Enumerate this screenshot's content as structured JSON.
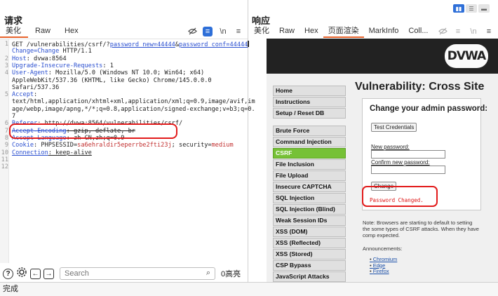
{
  "request": {
    "title": "请求",
    "tabs": [
      "美化",
      "Raw",
      "Hex"
    ],
    "lines": [
      {
        "n": "1",
        "parts": [
          [
            "GET /vulnerabilities/csrf/?",
            "v"
          ],
          [
            "password_new=44444",
            "k ul"
          ],
          [
            "&",
            "v"
          ],
          [
            "password_conf=44444",
            "k ul"
          ]
        ]
      },
      {
        "n": "",
        "parts": [
          [
            "Change=Change",
            "k"
          ],
          [
            " HTTP/1.1",
            "v"
          ]
        ]
      },
      {
        "n": "2",
        "parts": [
          [
            "Host",
            "k"
          ],
          [
            ": dvwa:8564",
            "v"
          ]
        ]
      },
      {
        "n": "3",
        "parts": [
          [
            "Upgrade-Insecure-Requests",
            "k"
          ],
          [
            ": 1",
            "v"
          ]
        ]
      },
      {
        "n": "4",
        "parts": [
          [
            "User-Agent",
            "k"
          ],
          [
            ": Mozilla/5.0 (Windows NT 10.0; Win64; x64)",
            "v"
          ]
        ]
      },
      {
        "n": "",
        "parts": [
          [
            "AppleWebKit/537.36 (KHTML, like Gecko) Chrome/145.0.0.0",
            "v"
          ]
        ]
      },
      {
        "n": "",
        "parts": [
          [
            "Safari/537.36",
            "v"
          ]
        ]
      },
      {
        "n": "5",
        "parts": [
          [
            "Accept",
            "k"
          ],
          [
            ":",
            "v"
          ]
        ]
      },
      {
        "n": "",
        "parts": [
          [
            "text/html,application/xhtml+xml,application/xml;q=0.9,image/avif,im",
            "v"
          ]
        ]
      },
      {
        "n": "",
        "parts": [
          [
            "age/webp,image/apng,*/*;q=0.8,application/signed-exchange;v=b3;q=0.",
            "v"
          ]
        ]
      },
      {
        "n": "",
        "parts": [
          [
            "7",
            "v"
          ]
        ]
      },
      {
        "n": "6",
        "parts": [
          [
            "Referer",
            "k"
          ],
          [
            ": http://dvwa:8564/vulnerabilities/csrf/",
            "v"
          ]
        ]
      },
      {
        "n": "7",
        "parts": [
          [
            "Accept-Encoding",
            "k strike"
          ],
          [
            ": gzip, deflate, br",
            "v strike"
          ]
        ]
      },
      {
        "n": "8",
        "parts": [
          [
            "Accept-Language",
            "k"
          ],
          [
            ": zh-CN,zh;q=0.9",
            "v"
          ]
        ]
      },
      {
        "n": "9",
        "parts": [
          [
            "Cookie",
            "k"
          ],
          [
            ": PHPSESSID=",
            "v"
          ],
          [
            "sa6ehraldir5eperrbe2fti23j",
            "r"
          ],
          [
            "; security=",
            "v"
          ],
          [
            "medium",
            "r"
          ]
        ]
      },
      {
        "n": "10",
        "parts": [
          [
            "Connection",
            "k ul"
          ],
          [
            ": keep-alive",
            "v ul"
          ]
        ]
      },
      {
        "n": "11",
        "parts": []
      },
      {
        "n": "12",
        "parts": []
      }
    ],
    "search_placeholder": "Search",
    "highlight_count": "0高亮"
  },
  "response": {
    "title": "响应",
    "tabs": [
      "美化",
      "Raw",
      "Hex",
      "页面渲染",
      "MarkInfo",
      "Coll..."
    ],
    "active_tab": 3
  },
  "dvwa": {
    "logo": "DVWA",
    "menu_group1": [
      "Home",
      "Instructions",
      "Setup / Reset DB"
    ],
    "menu_group2": [
      "Brute Force",
      "Command Injection",
      "CSRF",
      "File Inclusion",
      "File Upload",
      "Insecure CAPTCHA",
      "SQL Injection",
      "SQL Injection (Blind)",
      "Weak Session IDs",
      "XSS (DOM)",
      "XSS (Reflected)",
      "XSS (Stored)",
      "CSP Bypass",
      "JavaScript Attacks"
    ],
    "active_menu": "CSRF",
    "page_title": "Vulnerability: Cross Site",
    "form_heading": "Change your admin password:",
    "test_button": "Test Credentials",
    "new_password_label": "New password:",
    "confirm_password_label": "Confirm new password:",
    "change_button": "Change",
    "result_message": "Password Changed.",
    "note": "Note: Browsers are starting to default to setting the some types of CSRF attacks. When they have comp expected.",
    "announcements_label": "Announcements:",
    "links": [
      "Chromium",
      "Edge",
      "Firefox"
    ]
  },
  "status_text": "完成"
}
